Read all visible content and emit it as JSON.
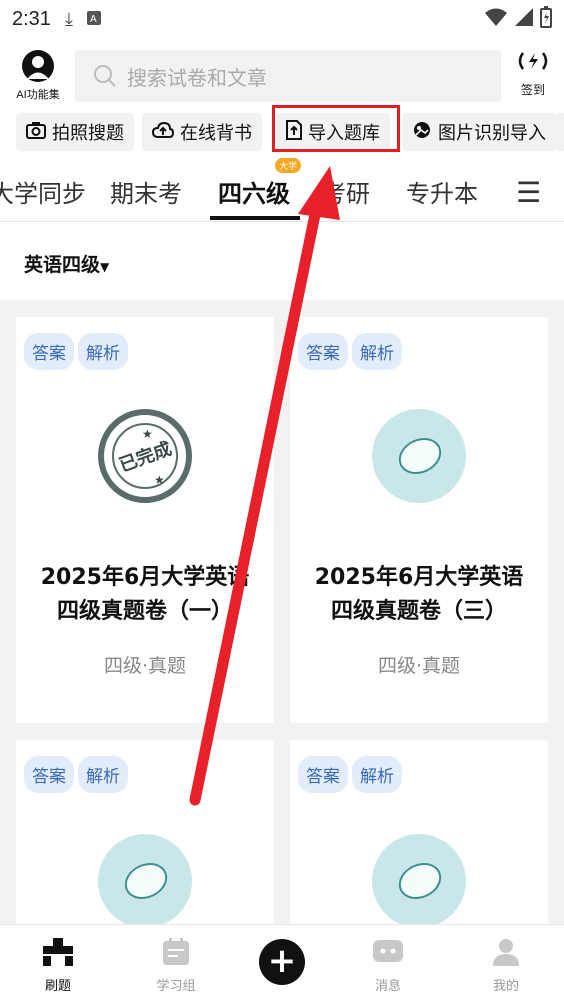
{
  "status_bar": {
    "time": "2:31"
  },
  "topbar": {
    "ai_label": "AI功能集",
    "search_placeholder": "搜索试卷和文章",
    "signin_label": "签到"
  },
  "quick_actions": [
    {
      "label": "拍照搜题",
      "icon": "camera-icon"
    },
    {
      "label": "在线背书",
      "icon": "cloud-upload-icon"
    },
    {
      "label": "导入题库",
      "icon": "import-file-icon",
      "highlighted": true
    },
    {
      "label": "图片识别导入",
      "icon": "image-recognize-icon"
    }
  ],
  "tabs": [
    {
      "label": "大学同步"
    },
    {
      "label": "期末考"
    },
    {
      "label": "四六级",
      "active": true,
      "badge": "大学"
    },
    {
      "label": "考研"
    },
    {
      "label": "专升本"
    }
  ],
  "filter": {
    "label": "英语四级"
  },
  "cards": [
    {
      "tags": [
        "答案",
        "解析"
      ],
      "title_line1": "2025年6月大学英语",
      "title_line2": "四级真题卷（一）",
      "subtitle": "四级·真题",
      "stamp": "已完成"
    },
    {
      "tags": [
        "答案",
        "解析"
      ],
      "title_line1": "2025年6月大学英语",
      "title_line2": "四级真题卷（三）",
      "subtitle": "四级·真题"
    },
    {
      "tags": [
        "答案",
        "解析"
      ]
    },
    {
      "tags": [
        "答案",
        "解析"
      ]
    }
  ],
  "bottom_nav": [
    {
      "label": "刷题",
      "active": true
    },
    {
      "label": "学习组"
    },
    {
      "label": "消息"
    },
    {
      "label": "我的"
    }
  ],
  "colors": {
    "highlight": "#e02020",
    "chip_bg": "#e3ecf9",
    "chip_text": "#3a6bb8",
    "badge": "#f5a623"
  }
}
